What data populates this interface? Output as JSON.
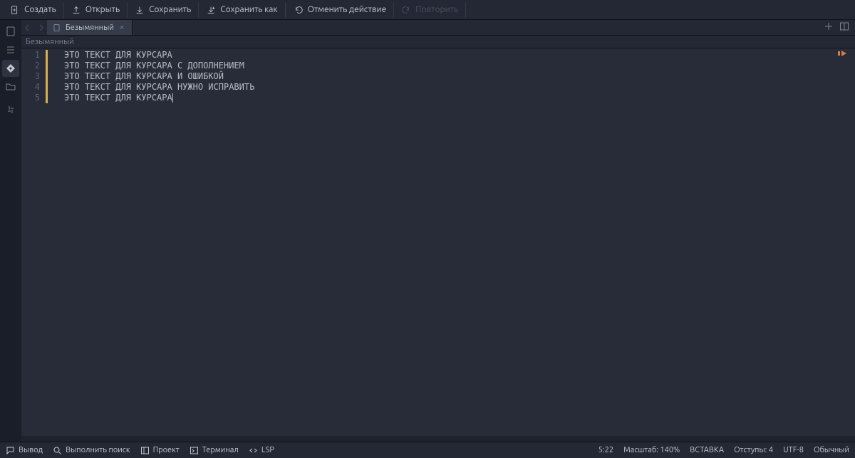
{
  "toolbar": {
    "create": "Создать",
    "open": "Открыть",
    "save": "Сохранить",
    "save_as": "Сохранить как",
    "undo": "Отменить действие",
    "redo": "Повторить"
  },
  "tab": {
    "title": "Безымянный"
  },
  "breadcrumb": "Безымянный",
  "editor": {
    "lines": [
      "ЭТО ТЕКСТ ДЛЯ КУРСАРА",
      "ЭТО ТЕКСТ ДЛЯ КУРСАРА С ДОПОЛНЕНИЕМ",
      "ЭТО ТЕКСТ ДЛЯ КУРСАРА И ОШИБКОЙ",
      "ЭТО ТЕКСТ ДЛЯ КУРСАРА НУЖНО ИСПРАВИТЬ",
      "ЭТО ТЕКСТ ДЛЯ КУРСАРА"
    ],
    "current_line_index": 4
  },
  "statusbar": {
    "output": "Вывод",
    "search": "Выполнить поиск",
    "project": "Проект",
    "terminal": "Терминал",
    "lsp": "LSP",
    "position": "5:22",
    "zoom": "Масштаб: 140%",
    "mode": "ВСТАВКА",
    "indent": "Отступы: 4",
    "encoding": "UTF-8",
    "filetype": "Обычный"
  }
}
